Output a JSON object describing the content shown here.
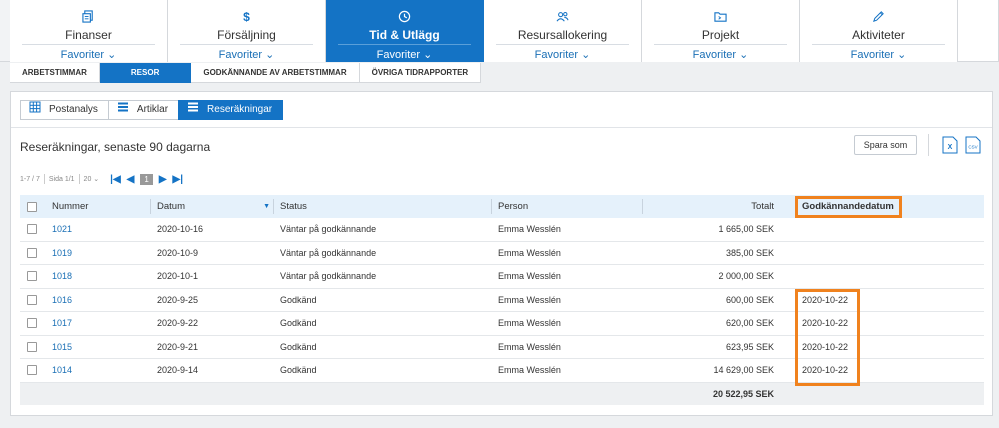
{
  "modules": [
    {
      "name": "Finanser",
      "fav": "Favoriter",
      "icon": "finance-icon",
      "active": false
    },
    {
      "name": "Försäljning",
      "fav": "Favoriter",
      "icon": "dollar-icon",
      "active": false
    },
    {
      "name": "Tid & Utlägg",
      "fav": "Favoriter",
      "icon": "clock-icon",
      "active": true
    },
    {
      "name": "Resursallokering",
      "fav": "Favoriter",
      "icon": "people-icon",
      "active": false
    },
    {
      "name": "Projekt",
      "fav": "Favoriter",
      "icon": "folder-icon",
      "active": false
    },
    {
      "name": "Aktiviteter",
      "fav": "Favoriter",
      "icon": "pen-icon",
      "active": false
    }
  ],
  "subtabs": [
    {
      "label": "Arbetstimmar",
      "active": false
    },
    {
      "label": "Resor",
      "active": true
    },
    {
      "label": "Godkännande av arbetstimmar",
      "active": false
    },
    {
      "label": "Övriga tidrapporter",
      "active": false
    }
  ],
  "views": [
    {
      "label": "Postanalys",
      "icon": "grid-icon",
      "active": false
    },
    {
      "label": "Artiklar",
      "icon": "list-icon",
      "active": false
    },
    {
      "label": "Reseräkningar",
      "icon": "list-icon",
      "active": true
    }
  ],
  "report": {
    "title": "Reseräkningar, senaste 90 dagarna",
    "save_label": "Spara som",
    "export_xls": "X",
    "export_csv": "CSV"
  },
  "pager": {
    "range": "1-7 / 7",
    "page": "Sida 1/1",
    "size": "20",
    "current": "1",
    "first": "|◀",
    "prev": "◀",
    "next": "▶",
    "last": "▶|"
  },
  "table": {
    "headers": {
      "nummer": "Nummer",
      "datum": "Datum",
      "status": "Status",
      "person": "Person",
      "totalt": "Totalt",
      "godkannandedatum": "Godkännandedatum"
    },
    "rows": [
      {
        "nummer": "1021",
        "datum": "2020-10-16",
        "status": "Väntar på godkännande",
        "person": "Emma Wesslén",
        "totalt": "1 665,00 SEK",
        "godk": ""
      },
      {
        "nummer": "1019",
        "datum": "2020-10-9",
        "status": "Väntar på godkännande",
        "person": "Emma Wesslén",
        "totalt": "385,00 SEK",
        "godk": ""
      },
      {
        "nummer": "1018",
        "datum": "2020-10-1",
        "status": "Väntar på godkännande",
        "person": "Emma Wesslén",
        "totalt": "2 000,00 SEK",
        "godk": ""
      },
      {
        "nummer": "1016",
        "datum": "2020-9-25",
        "status": "Godkänd",
        "person": "Emma Wesslén",
        "totalt": "600,00 SEK",
        "godk": "2020-10-22"
      },
      {
        "nummer": "1017",
        "datum": "2020-9-22",
        "status": "Godkänd",
        "person": "Emma Wesslén",
        "totalt": "620,00 SEK",
        "godk": "2020-10-22"
      },
      {
        "nummer": "1015",
        "datum": "2020-9-21",
        "status": "Godkänd",
        "person": "Emma Wesslén",
        "totalt": "623,95 SEK",
        "godk": "2020-10-22"
      },
      {
        "nummer": "1014",
        "datum": "2020-9-14",
        "status": "Godkänd",
        "person": "Emma Wesslén",
        "totalt": "14 629,00 SEK",
        "godk": "2020-10-22"
      }
    ],
    "total": "20 522,95 SEK"
  },
  "colors": {
    "accent": "#1473c5",
    "highlight": "#f0821e",
    "link": "#1a6fb5",
    "header_bg": "#e5f1fb"
  }
}
